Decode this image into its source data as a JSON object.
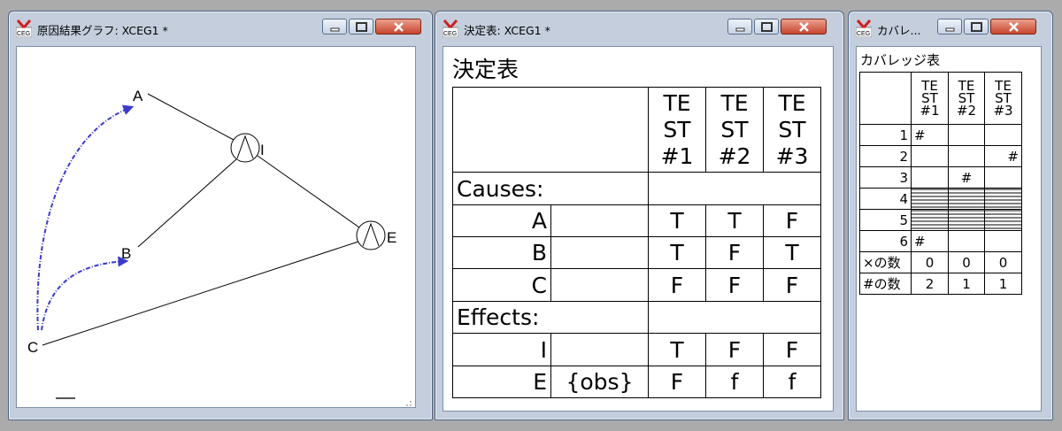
{
  "windows": {
    "graph": {
      "title": "原因結果グラフ: XCEG1 *",
      "nodes": [
        {
          "id": "A",
          "label": "A"
        },
        {
          "id": "B",
          "label": "B"
        },
        {
          "id": "C",
          "label": "C"
        },
        {
          "id": "I",
          "label": "I",
          "type": "and"
        },
        {
          "id": "E",
          "label": "E",
          "type": "and"
        }
      ],
      "edges": [
        {
          "from": "A",
          "to": "I",
          "style": "solid"
        },
        {
          "from": "B",
          "to": "I",
          "style": "solid"
        },
        {
          "from": "I",
          "to": "E",
          "style": "solid"
        },
        {
          "from": "C",
          "to": "E",
          "style": "solid"
        },
        {
          "from": "C",
          "to": "A",
          "style": "constraint-dashed"
        },
        {
          "from": "C",
          "to": "B",
          "style": "constraint-dashed"
        }
      ],
      "constraint_color": "#3a3ad0"
    },
    "decision": {
      "title": "決定表: XCEG1 *",
      "heading": "決定表",
      "tests": [
        "TE\nST\n#1",
        "TE\nST\n#2",
        "TE\nST\n#3"
      ],
      "causes_label": "Causes:",
      "effects_label": "Effects:",
      "causes": [
        {
          "name": "A",
          "note": "",
          "values": [
            "T",
            "T",
            "F"
          ]
        },
        {
          "name": "B",
          "note": "",
          "values": [
            "T",
            "F",
            "T"
          ]
        },
        {
          "name": "C",
          "note": "",
          "values": [
            "F",
            "F",
            "F"
          ]
        }
      ],
      "effects": [
        {
          "name": "I",
          "note": "",
          "values": [
            "T",
            "F",
            "F"
          ]
        },
        {
          "name": "E",
          "note": "{obs}",
          "values": [
            "F",
            "f",
            "f"
          ]
        }
      ]
    },
    "coverage": {
      "title": "カバレ...",
      "heading": "カバレッジ表",
      "tests": [
        "TE\nST\n#1",
        "TE\nST\n#2",
        "TE\nST\n#3"
      ],
      "rows": [
        {
          "label": "1",
          "cells": [
            "#",
            "",
            ""
          ]
        },
        {
          "label": "2",
          "cells": [
            "",
            "",
            "#"
          ]
        },
        {
          "label": "3",
          "cells": [
            "",
            "#",
            ""
          ]
        },
        {
          "label": "4",
          "cells": [
            "",
            "",
            ""
          ],
          "hatched": true
        },
        {
          "label": "5",
          "cells": [
            "",
            "",
            ""
          ],
          "hatched": true
        },
        {
          "label": "6",
          "cells": [
            "#",
            "",
            ""
          ]
        }
      ],
      "summary": [
        {
          "label": "×の数",
          "cells": [
            "0",
            "0",
            "0"
          ]
        },
        {
          "label": "#の数",
          "cells": [
            "2",
            "1",
            "1"
          ]
        }
      ]
    }
  },
  "colors": {
    "desktop": "#ababab",
    "titlebar": "#c4cedd",
    "close_button": "#c8452e"
  }
}
